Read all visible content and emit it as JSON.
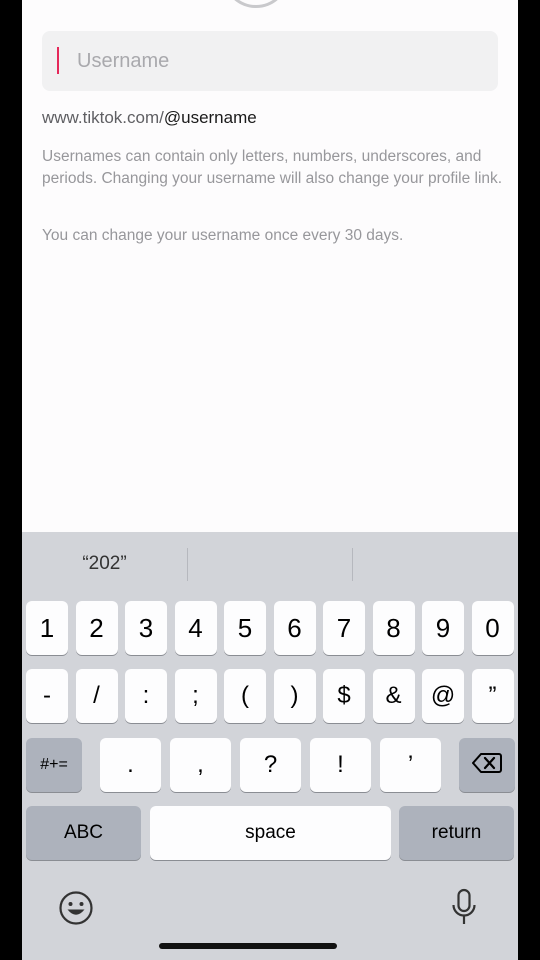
{
  "form": {
    "placeholder": "Username",
    "url_prefix": "www.tiktok.com/",
    "url_handle": "@username",
    "help_text": "Usernames can contain only letters, numbers, underscores, and periods. Changing your username will also change your profile link.",
    "limit_text": "You can change your username once every 30 days."
  },
  "keyboard": {
    "suggestions": [
      "“202”",
      "",
      ""
    ],
    "row1": [
      "1",
      "2",
      "3",
      "4",
      "5",
      "6",
      "7",
      "8",
      "9",
      "0"
    ],
    "row2": [
      "-",
      "/",
      ":",
      ";",
      "(",
      ")",
      "$",
      "&",
      "@",
      "”"
    ],
    "row3": {
      "shift_label": "#+=",
      "keys": [
        ".",
        ",",
        "?",
        "!",
        "’"
      ]
    },
    "row4": {
      "abc_label": "ABC",
      "space_label": "space",
      "return_label": "return"
    },
    "icons": {
      "delete": "backspace-icon",
      "emoji": "emoji-icon",
      "mic": "microphone-icon"
    }
  },
  "colors": {
    "caret": "#e5285a",
    "keyboard_bg": "#d2d4d9",
    "key_light": "#fdfdfe",
    "key_dark": "#adb2bc"
  }
}
